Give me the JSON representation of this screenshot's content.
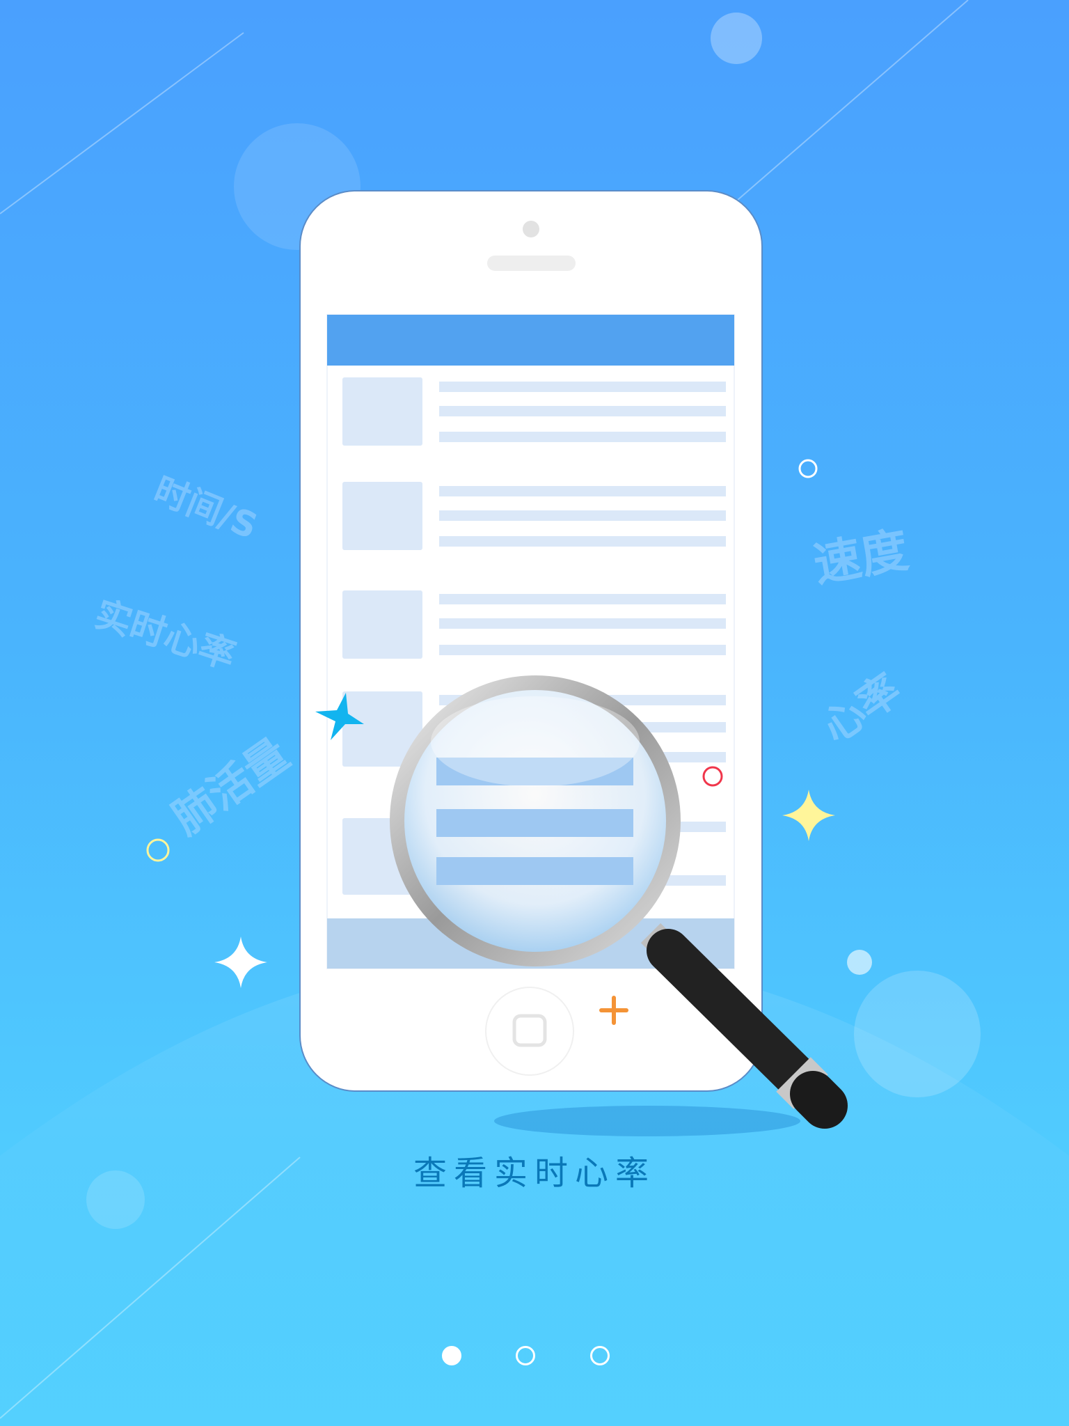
{
  "floating_labels": [
    "时间/S",
    "实时心率",
    "肺活量",
    "速度",
    "心率"
  ],
  "caption": "查看实时心率",
  "pager": {
    "pages": 3,
    "active_index": 0
  },
  "colors": {
    "background_top": "#4aa0fe",
    "background_bottom": "#54d0fe",
    "caption": "#0a78b8",
    "screen_header": "#52a2f0",
    "list_placeholder": "#dbe8f8",
    "star_blue": "#12b4ef",
    "star_yellow": "#fff59a",
    "plus_orange": "#f49336",
    "ring_red": "#f0364b"
  },
  "icons": [
    "magnifier-icon",
    "star-icon",
    "sparkle-icon",
    "plus-icon",
    "ring-icon",
    "home-button-icon"
  ]
}
